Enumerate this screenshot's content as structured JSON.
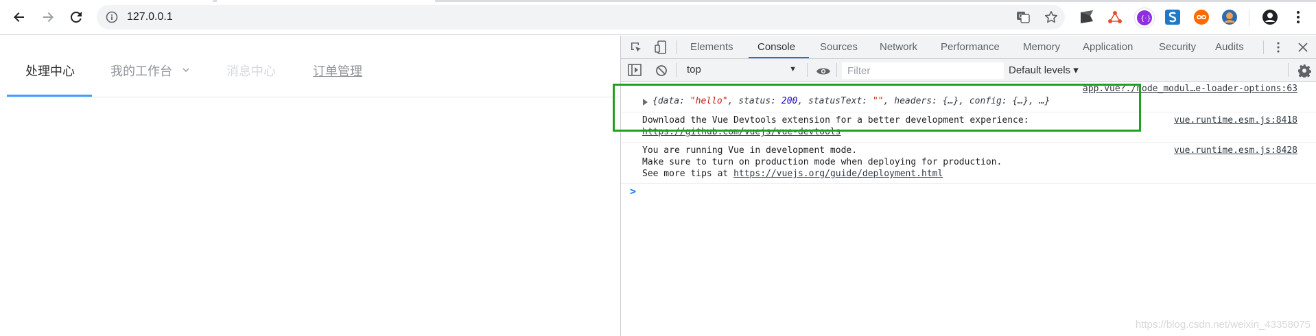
{
  "browser": {
    "url": "127.0.0.1",
    "icons": [
      "back-icon",
      "forward-icon",
      "reload-icon",
      "info-icon",
      "translate-icon",
      "star-icon",
      "profile-icon",
      "menu-icon"
    ]
  },
  "page": {
    "menu": {
      "items": [
        {
          "label": "处理中心",
          "state": "active"
        },
        {
          "label": "我的工作台",
          "state": "submenu"
        },
        {
          "label": "消息中心",
          "state": "disabled"
        },
        {
          "label": "订单管理",
          "state": "link"
        }
      ],
      "accent": "#409eff"
    }
  },
  "devtools": {
    "tabs": [
      "Elements",
      "Console",
      "Sources",
      "Network",
      "Performance",
      "Memory",
      "Application",
      "Security",
      "Audits"
    ],
    "selected_tab": "Console",
    "context": "top",
    "filter_placeholder": "Filter",
    "levels": "Default levels ▾",
    "messages": [
      {
        "source": "app.vue?./node_modul…e-loader-options:63",
        "object": {
          "open": "{",
          "k1": "data",
          "v1": "\"hello\"",
          "k2": "status",
          "v2": "200",
          "k3": "statusText",
          "v3": "\"\"",
          "k4": "headers",
          "v4": "{…}",
          "k5": "config",
          "v5": "{…}",
          "tail": "…}"
        }
      },
      {
        "source": "vue.runtime.esm.js:8418",
        "line1": "Download the Vue Devtools extension for a better development experience:",
        "link": "https://github.com/vuejs/vue-devtools"
      },
      {
        "source": "vue.runtime.esm.js:8428",
        "line1": "You are running Vue in development mode.",
        "line2": "Make sure to turn on production mode when deploying for production.",
        "line3_prefix": "See more tips at ",
        "link": "https://vuejs.org/guide/deployment.html"
      }
    ],
    "prompt_symbol": ">"
  },
  "watermark": "https://blog.csdn.net/weixin_43358075",
  "colors": {
    "highlight_box": "#20a020",
    "devtools_link": "#1a73e8"
  }
}
